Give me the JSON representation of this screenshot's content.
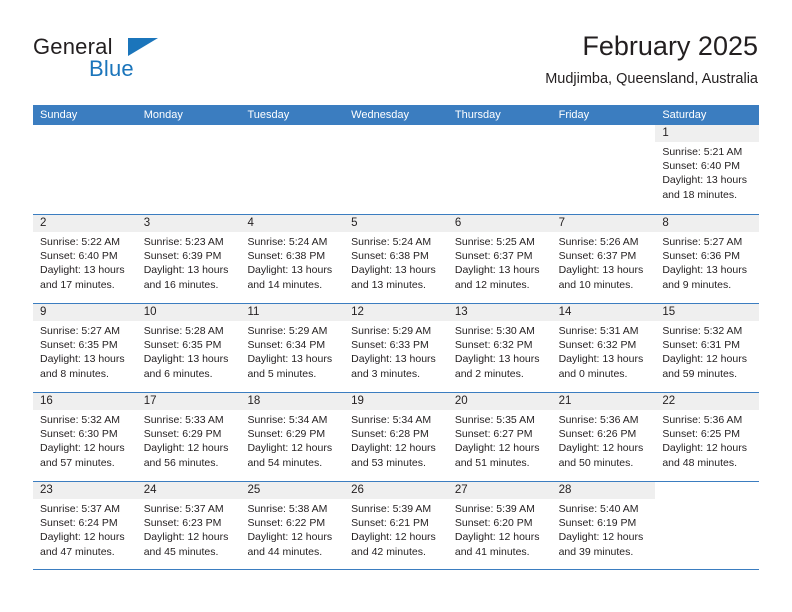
{
  "brand": {
    "name_part1": "General",
    "name_part2": "Blue",
    "accent_color": "#1b75bb"
  },
  "header": {
    "title": "February 2025",
    "location": "Mudjimba, Queensland, Australia"
  },
  "calendar": {
    "header_color": "#3b7dc0",
    "weekday_headers": [
      "Sunday",
      "Monday",
      "Tuesday",
      "Wednesday",
      "Thursday",
      "Friday",
      "Saturday"
    ],
    "weeks": [
      [
        {
          "day": "",
          "lines": []
        },
        {
          "day": "",
          "lines": []
        },
        {
          "day": "",
          "lines": []
        },
        {
          "day": "",
          "lines": []
        },
        {
          "day": "",
          "lines": []
        },
        {
          "day": "",
          "lines": []
        },
        {
          "day": "1",
          "lines": [
            "Sunrise: 5:21 AM",
            "Sunset: 6:40 PM",
            "Daylight: 13 hours",
            "and 18 minutes."
          ]
        }
      ],
      [
        {
          "day": "2",
          "lines": [
            "Sunrise: 5:22 AM",
            "Sunset: 6:40 PM",
            "Daylight: 13 hours",
            "and 17 minutes."
          ]
        },
        {
          "day": "3",
          "lines": [
            "Sunrise: 5:23 AM",
            "Sunset: 6:39 PM",
            "Daylight: 13 hours",
            "and 16 minutes."
          ]
        },
        {
          "day": "4",
          "lines": [
            "Sunrise: 5:24 AM",
            "Sunset: 6:38 PM",
            "Daylight: 13 hours",
            "and 14 minutes."
          ]
        },
        {
          "day": "5",
          "lines": [
            "Sunrise: 5:24 AM",
            "Sunset: 6:38 PM",
            "Daylight: 13 hours",
            "and 13 minutes."
          ]
        },
        {
          "day": "6",
          "lines": [
            "Sunrise: 5:25 AM",
            "Sunset: 6:37 PM",
            "Daylight: 13 hours",
            "and 12 minutes."
          ]
        },
        {
          "day": "7",
          "lines": [
            "Sunrise: 5:26 AM",
            "Sunset: 6:37 PM",
            "Daylight: 13 hours",
            "and 10 minutes."
          ]
        },
        {
          "day": "8",
          "lines": [
            "Sunrise: 5:27 AM",
            "Sunset: 6:36 PM",
            "Daylight: 13 hours",
            "and 9 minutes."
          ]
        }
      ],
      [
        {
          "day": "9",
          "lines": [
            "Sunrise: 5:27 AM",
            "Sunset: 6:35 PM",
            "Daylight: 13 hours",
            "and 8 minutes."
          ]
        },
        {
          "day": "10",
          "lines": [
            "Sunrise: 5:28 AM",
            "Sunset: 6:35 PM",
            "Daylight: 13 hours",
            "and 6 minutes."
          ]
        },
        {
          "day": "11",
          "lines": [
            "Sunrise: 5:29 AM",
            "Sunset: 6:34 PM",
            "Daylight: 13 hours",
            "and 5 minutes."
          ]
        },
        {
          "day": "12",
          "lines": [
            "Sunrise: 5:29 AM",
            "Sunset: 6:33 PM",
            "Daylight: 13 hours",
            "and 3 minutes."
          ]
        },
        {
          "day": "13",
          "lines": [
            "Sunrise: 5:30 AM",
            "Sunset: 6:32 PM",
            "Daylight: 13 hours",
            "and 2 minutes."
          ]
        },
        {
          "day": "14",
          "lines": [
            "Sunrise: 5:31 AM",
            "Sunset: 6:32 PM",
            "Daylight: 13 hours",
            "and 0 minutes."
          ]
        },
        {
          "day": "15",
          "lines": [
            "Sunrise: 5:32 AM",
            "Sunset: 6:31 PM",
            "Daylight: 12 hours",
            "and 59 minutes."
          ]
        }
      ],
      [
        {
          "day": "16",
          "lines": [
            "Sunrise: 5:32 AM",
            "Sunset: 6:30 PM",
            "Daylight: 12 hours",
            "and 57 minutes."
          ]
        },
        {
          "day": "17",
          "lines": [
            "Sunrise: 5:33 AM",
            "Sunset: 6:29 PM",
            "Daylight: 12 hours",
            "and 56 minutes."
          ]
        },
        {
          "day": "18",
          "lines": [
            "Sunrise: 5:34 AM",
            "Sunset: 6:29 PM",
            "Daylight: 12 hours",
            "and 54 minutes."
          ]
        },
        {
          "day": "19",
          "lines": [
            "Sunrise: 5:34 AM",
            "Sunset: 6:28 PM",
            "Daylight: 12 hours",
            "and 53 minutes."
          ]
        },
        {
          "day": "20",
          "lines": [
            "Sunrise: 5:35 AM",
            "Sunset: 6:27 PM",
            "Daylight: 12 hours",
            "and 51 minutes."
          ]
        },
        {
          "day": "21",
          "lines": [
            "Sunrise: 5:36 AM",
            "Sunset: 6:26 PM",
            "Daylight: 12 hours",
            "and 50 minutes."
          ]
        },
        {
          "day": "22",
          "lines": [
            "Sunrise: 5:36 AM",
            "Sunset: 6:25 PM",
            "Daylight: 12 hours",
            "and 48 minutes."
          ]
        }
      ],
      [
        {
          "day": "23",
          "lines": [
            "Sunrise: 5:37 AM",
            "Sunset: 6:24 PM",
            "Daylight: 12 hours",
            "and 47 minutes."
          ]
        },
        {
          "day": "24",
          "lines": [
            "Sunrise: 5:37 AM",
            "Sunset: 6:23 PM",
            "Daylight: 12 hours",
            "and 45 minutes."
          ]
        },
        {
          "day": "25",
          "lines": [
            "Sunrise: 5:38 AM",
            "Sunset: 6:22 PM",
            "Daylight: 12 hours",
            "and 44 minutes."
          ]
        },
        {
          "day": "26",
          "lines": [
            "Sunrise: 5:39 AM",
            "Sunset: 6:21 PM",
            "Daylight: 12 hours",
            "and 42 minutes."
          ]
        },
        {
          "day": "27",
          "lines": [
            "Sunrise: 5:39 AM",
            "Sunset: 6:20 PM",
            "Daylight: 12 hours",
            "and 41 minutes."
          ]
        },
        {
          "day": "28",
          "lines": [
            "Sunrise: 5:40 AM",
            "Sunset: 6:19 PM",
            "Daylight: 12 hours",
            "and 39 minutes."
          ]
        },
        {
          "day": "",
          "lines": []
        }
      ]
    ]
  }
}
